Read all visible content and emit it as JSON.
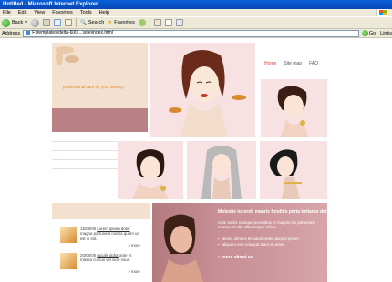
{
  "window": {
    "title": "Untitled - Microsoft Internet Explorer"
  },
  "menu": [
    "File",
    "Edit",
    "View",
    "Favorites",
    "Tools",
    "Help"
  ],
  "toolbar": {
    "back": "Back",
    "search": "Search",
    "favorites": "Favorites"
  },
  "address": {
    "label": "Address",
    "url": "F:\\templates\\delta-600\\...\\site\\index.html",
    "go": "Go",
    "links": "Links"
  },
  "site": {
    "slogan": "professional care for your beauty!",
    "nav": [
      "Home",
      "Site map",
      "FAQ"
    ],
    "news": [
      {
        "date": "15/08/05",
        "title": "Lorem ipsum dolor",
        "text": "magna parturient nostra quam ut elit in est.",
        "more": "» more"
      },
      {
        "date": "20/08/05",
        "title": "Iaculis dolor",
        "text": "ante et massa cursus vel sem risus.",
        "more": "» more"
      }
    ],
    "feature": {
      "title": "Molestie locereb mauris fondiko perta ketlanar der",
      "body": "Cum sociis natoque penatibus et magnis dis parturient montes et ulla ullamcorper tellus.",
      "list": [
        "donec ultrices tincidunt mollis aliquet ipsum",
        "aliquam erat volutpat diam sit amet"
      ],
      "more": "» more about us"
    }
  }
}
